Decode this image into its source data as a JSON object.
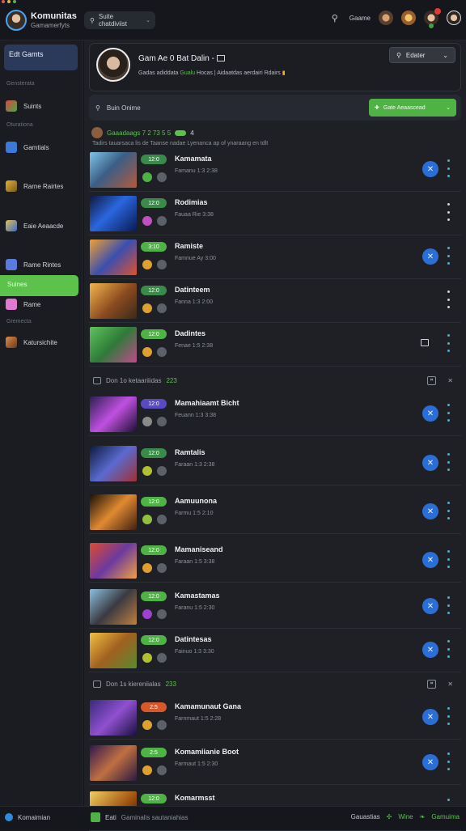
{
  "app": {
    "title": "Komunitas",
    "subtitle": "Gamamerfyts",
    "search_label": "Suite chatdiviist"
  },
  "topbar": {
    "link": "Gaame"
  },
  "sidebar": {
    "card_label": "Edt Gamts",
    "captions": [
      "Gensterata",
      "Oturationa",
      "Gremecta"
    ],
    "items": [
      "Suints",
      "Gamtials",
      "Rarne Rairtes",
      "Eaie Aeaacde",
      "Rame Rintes",
      "Rame",
      "Katursichite"
    ],
    "active_label": "Suines"
  },
  "profile": {
    "name": "Gam Ae 0 Bat Dalin -",
    "status_a": "Gadas adiddata",
    "status_g": "Gualu",
    "status_b": "Hocas | Aidaatdas aerdairi Rdairs"
  },
  "filter": {
    "label": "Edater"
  },
  "search": {
    "label": "Buin Onime"
  },
  "add_button": {
    "label": "Gate Aeaascead"
  },
  "online": {
    "header": "Gaaadaags 7 2 73 5 5",
    "count": "4",
    "sub": "Tadirs tauarsaca lis de Taanse nadae Lyenanca ap of ynaraang en tdlt"
  },
  "groups": [
    {
      "label": "Don 1o ketaariiidas",
      "tag": "223"
    },
    {
      "label": "Don 1s kiereniialas",
      "tag": "233"
    }
  ],
  "rows": [
    {
      "name": "Kamamata",
      "sub": "Famanu 1:3 2:38",
      "level": "12:0",
      "n": ""
    },
    {
      "name": "Rodimias",
      "sub": "Fauaa Rie 3:38",
      "level": "12:0",
      "n": ""
    },
    {
      "name": "Ramiste",
      "sub": "Famnue Ay 3:00",
      "level": "3:10",
      "n": "1:0"
    },
    {
      "name": "Datinteem",
      "sub": "Fanna 1:3 2:00",
      "level": "12:0",
      "n": ""
    },
    {
      "name": "Dadintes",
      "sub": "Fenae 1:5 2:38",
      "level": "12:0",
      "n": "1:0"
    },
    {
      "name": "Mamahiaamt Bicht",
      "sub": "Feuann 1:3 3:38",
      "level": "12:0",
      "n": ""
    },
    {
      "name": "Ramtalis",
      "sub": "Faraan 1:3 2:38",
      "level": "12:0",
      "n": ""
    },
    {
      "name": "Aamuunona",
      "sub": "Farmu 1:5 2:10",
      "level": "12:0",
      "n": ""
    },
    {
      "name": "Mamaniseand",
      "sub": "Faraan 1:5 3:38",
      "level": "12:0",
      "n": ""
    },
    {
      "name": "Kamastamas",
      "sub": "Faranu 1:5 2:30",
      "level": "12:0",
      "n": ""
    },
    {
      "name": "Datintesas",
      "sub": "Fainuo 1:3 3:30",
      "level": "12:0",
      "n": ""
    },
    {
      "name": "Kamamunaut Gana",
      "sub": "Farnmaut 1:5 2:28",
      "level": "2:5",
      "n": ""
    },
    {
      "name": "Komamiianie Boot",
      "sub": "Farmaut 1:5 2:30",
      "level": "2:5",
      "n": ""
    },
    {
      "name": "Komarmsst",
      "sub": "",
      "level": "12:0",
      "n": ""
    }
  ],
  "bottombar": {
    "left": "Komaimian",
    "mid_a": "Eati",
    "mid_b": "Gaminalis sautaniahias",
    "right_a": "Gauastias",
    "right_b": "Wine",
    "right_c": "Gamuima"
  }
}
